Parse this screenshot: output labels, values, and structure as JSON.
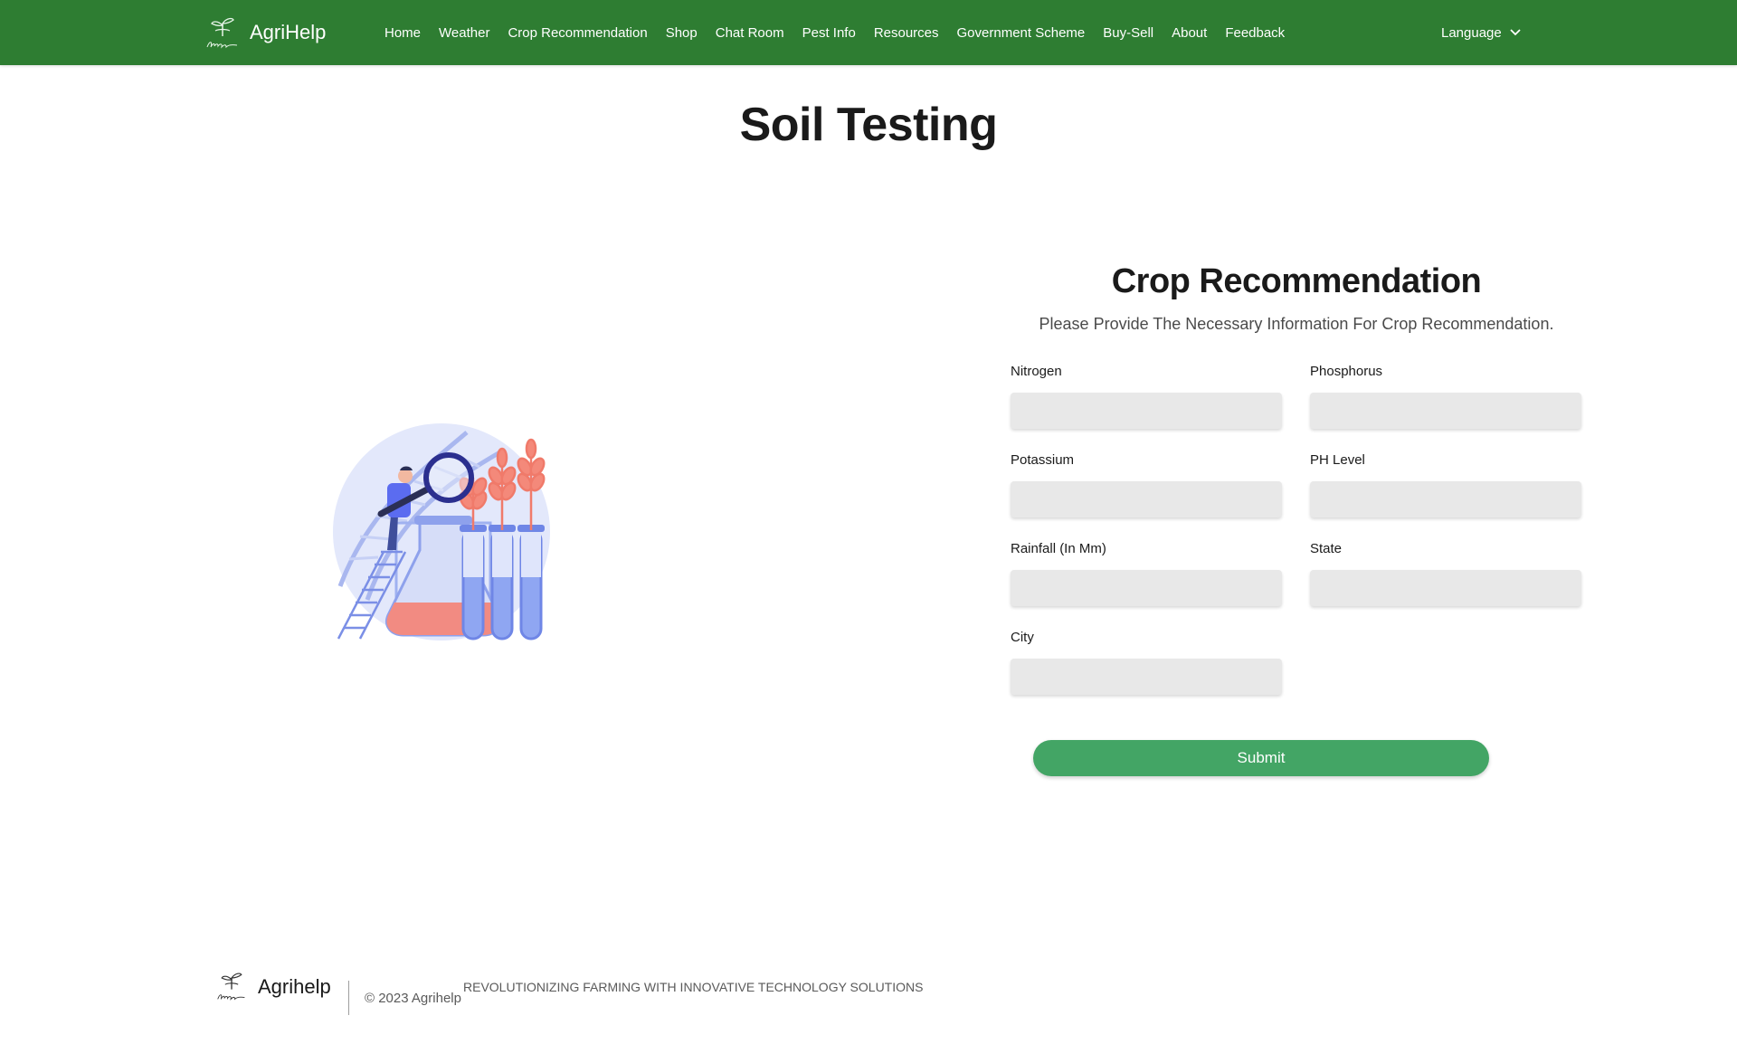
{
  "navbar": {
    "brand": "AgriHelp",
    "links": [
      "Home",
      "Weather",
      "Crop Recommendation",
      "Shop",
      "Chat Room",
      "Pest Info",
      "Resources",
      "Government Scheme",
      "Buy-Sell",
      "About",
      "Feedback"
    ],
    "language_label": "Language"
  },
  "page": {
    "title": "Soil Testing"
  },
  "form": {
    "title": "Crop Recommendation",
    "subtitle": "Please Provide The Necessary Information For Crop Recommendation.",
    "fields": [
      {
        "label": "Nitrogen",
        "value": ""
      },
      {
        "label": "Phosphorus",
        "value": ""
      },
      {
        "label": "Potassium",
        "value": ""
      },
      {
        "label": "PH Level",
        "value": ""
      },
      {
        "label": "Rainfall (In Mm)",
        "value": ""
      },
      {
        "label": "State",
        "value": ""
      },
      {
        "label": "City",
        "value": ""
      }
    ],
    "submit_label": "Submit"
  },
  "footer": {
    "brand": "Agrihelp",
    "copyright": "© 2023 Agrihelp",
    "tagline": "REVOLUTIONIZING FARMING WITH INNOVATIVE TECHNOLOGY SOLUTIONS"
  },
  "colors": {
    "navbar": "#2e7d32",
    "submit": "#43a565",
    "input_bg": "#e8e8e8"
  },
  "icons": {
    "logo": "sprout-logo-icon",
    "language": "chevron-down-icon"
  }
}
